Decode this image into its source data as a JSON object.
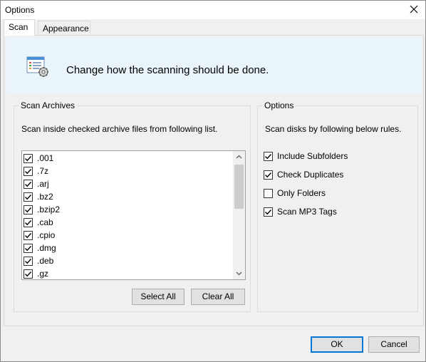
{
  "window": {
    "title": "Options"
  },
  "tabs": [
    {
      "label": "Scan",
      "active": true
    },
    {
      "label": "Appearance",
      "active": false
    }
  ],
  "header": {
    "text": "Change how the scanning should be done.",
    "icon": "settings-list-icon",
    "band_color": "#eaf4fb"
  },
  "archives": {
    "title": "Scan Archives",
    "description": "Scan inside checked archive files from following list.",
    "items": [
      {
        "label": ".001",
        "checked": true
      },
      {
        "label": ".7z",
        "checked": true
      },
      {
        "label": ".arj",
        "checked": true
      },
      {
        "label": ".bz2",
        "checked": true
      },
      {
        "label": ".bzip2",
        "checked": true
      },
      {
        "label": ".cab",
        "checked": true
      },
      {
        "label": ".cpio",
        "checked": true
      },
      {
        "label": ".dmg",
        "checked": true
      },
      {
        "label": ".deb",
        "checked": true
      },
      {
        "label": ".gz",
        "checked": true
      }
    ],
    "select_all_label": "Select All",
    "clear_all_label": "Clear All"
  },
  "options": {
    "title": "Options",
    "description": "Scan disks by following below rules.",
    "items": [
      {
        "label": "Include Subfolders",
        "checked": true
      },
      {
        "label": "Check Duplicates",
        "checked": true
      },
      {
        "label": "Only Folders",
        "checked": false
      },
      {
        "label": "Scan MP3 Tags",
        "checked": true
      }
    ]
  },
  "footer": {
    "ok_label": "OK",
    "cancel_label": "Cancel"
  },
  "colors": {
    "accent": "#0078d7"
  }
}
